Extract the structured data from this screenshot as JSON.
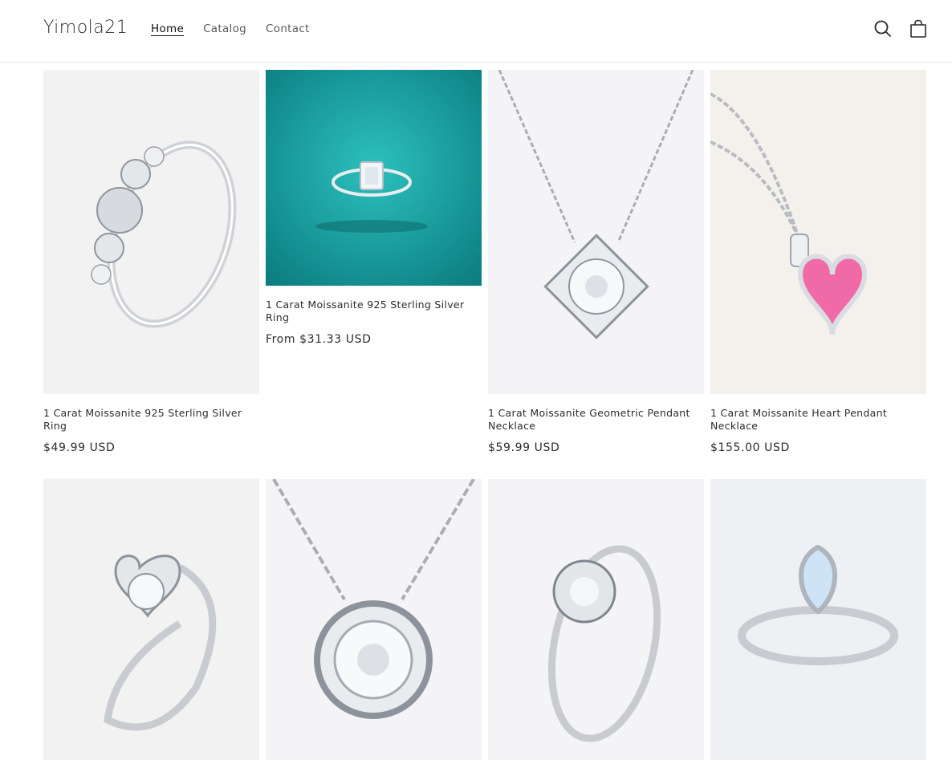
{
  "header": {
    "logo": "Yimola21",
    "nav": [
      {
        "label": "Home",
        "active": true
      },
      {
        "label": "Catalog",
        "active": false
      },
      {
        "label": "Contact",
        "active": false
      }
    ],
    "icons": [
      "search-icon",
      "cart-icon"
    ]
  },
  "products": [
    {
      "title": "1 Carat Moissanite 925 Sterling Silver Ring",
      "price": "$49.99 USD",
      "image": "ring-three-stone"
    },
    {
      "title": "1 Carat Moissanite 925 Sterling Silver Ring",
      "price": "From $31.33 USD",
      "image": "ring-emerald-cut-teal"
    },
    {
      "title": "1 Carat Moissanite Geometric Pendant Necklace",
      "price": "$59.99 USD",
      "image": "necklace-square-halo"
    },
    {
      "title": "1 Carat Moissanite Heart Pendant Necklace",
      "price": "$155.00 USD",
      "image": "necklace-pink-heart"
    },
    {
      "title": "",
      "price": "",
      "image": "ring-heart-swirl"
    },
    {
      "title": "",
      "price": "",
      "image": "necklace-bezel-round"
    },
    {
      "title": "",
      "price": "",
      "image": "ring-solitaire-twist"
    },
    {
      "title": "",
      "price": "",
      "image": "ring-pear-halo"
    }
  ],
  "colors": {
    "accent_teal": "#17a3a3",
    "pink_stone": "#f06aa8",
    "silver": "#c9ccd1"
  }
}
